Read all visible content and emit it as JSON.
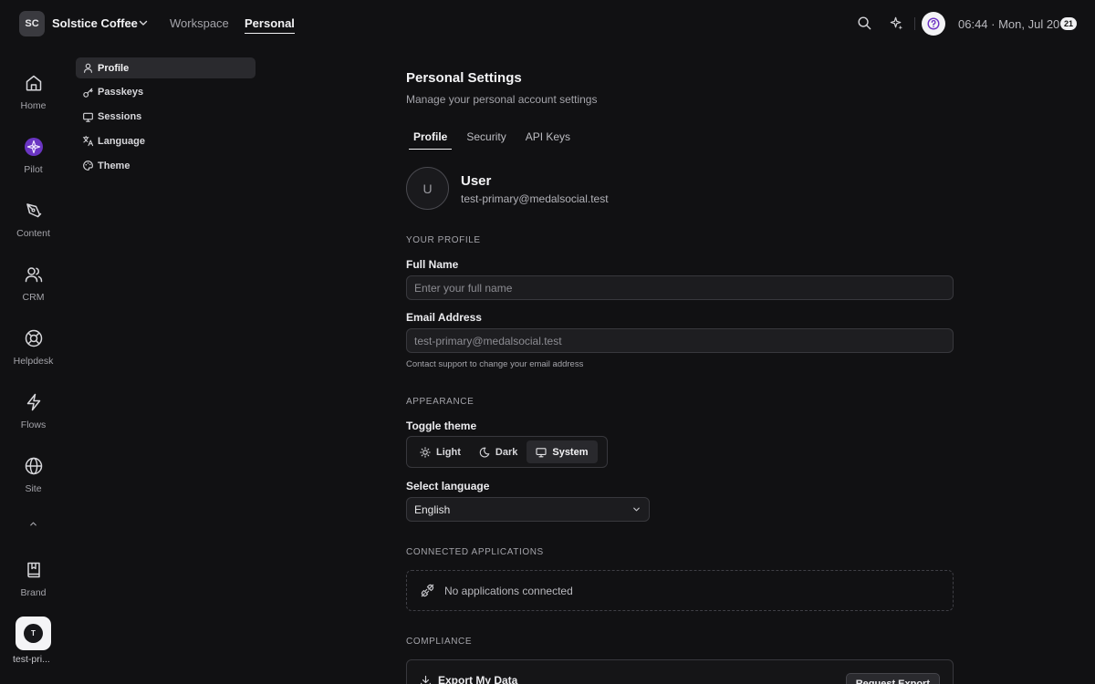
{
  "topbar": {
    "org_initials": "SC",
    "org_name": "Solstice Coffee",
    "nav": {
      "workspace": "Workspace",
      "personal": "Personal",
      "active": "Personal"
    },
    "time": "06:44 · Mon, Jul 20",
    "notification_count": "21",
    "icons": [
      "search-icon",
      "sparkle-icon",
      "help-icon",
      "chevron-down-icon"
    ]
  },
  "rail": {
    "items": [
      {
        "label": "Home",
        "icon": "home-icon"
      },
      {
        "label": "Pilot",
        "icon": "pilot-icon"
      },
      {
        "label": "Content",
        "icon": "pen-icon"
      },
      {
        "label": "CRM",
        "icon": "users-icon"
      },
      {
        "label": "Helpdesk",
        "icon": "lifebuoy-icon"
      },
      {
        "label": "Flows",
        "icon": "lightning-icon"
      },
      {
        "label": "Site",
        "icon": "globe-icon"
      },
      {
        "label": "Brand",
        "icon": "book-icon"
      }
    ],
    "user": {
      "initial": "T",
      "label": "test-pri..."
    },
    "accent": "#8b4fd8"
  },
  "submenu": {
    "items": [
      {
        "label": "Profile",
        "icon": "user-icon",
        "active": true
      },
      {
        "label": "Passkeys",
        "icon": "key-icon",
        "active": false
      },
      {
        "label": "Sessions",
        "icon": "monitor-icon",
        "active": false
      },
      {
        "label": "Language",
        "icon": "translate-icon",
        "active": false
      },
      {
        "label": "Theme",
        "icon": "palette-icon",
        "active": false
      }
    ]
  },
  "main": {
    "title": "Personal Settings",
    "subtitle": "Manage your personal account settings",
    "tabs": [
      {
        "label": "Profile",
        "active": true
      },
      {
        "label": "Security",
        "active": false
      },
      {
        "label": "API Keys",
        "active": false
      }
    ],
    "user": {
      "avatar_initial": "U",
      "name": "User",
      "email": "test-primary@medalsocial.test"
    },
    "profile": {
      "heading": "YOUR PROFILE",
      "full_name_label": "Full Name",
      "full_name_placeholder": "Enter your full name",
      "full_name_value": "",
      "email_label": "Email Address",
      "email_value": "test-primary@medalsocial.test",
      "email_help": "Contact support to change your email address"
    },
    "appearance": {
      "heading": "APPEARANCE",
      "toggle_label": "Toggle theme",
      "options": [
        {
          "label": "Light",
          "icon": "sun-icon"
        },
        {
          "label": "Dark",
          "icon": "moon-icon"
        },
        {
          "label": "System",
          "icon": "monitor-icon"
        }
      ],
      "selected": "System",
      "language_label": "Select language",
      "language_value": "English"
    },
    "connected": {
      "heading": "CONNECTED APPLICATIONS",
      "empty_text": "No applications connected"
    },
    "compliance": {
      "heading": "COMPLIANCE",
      "export_title": "Export My Data",
      "export_button": "Request Export"
    }
  }
}
